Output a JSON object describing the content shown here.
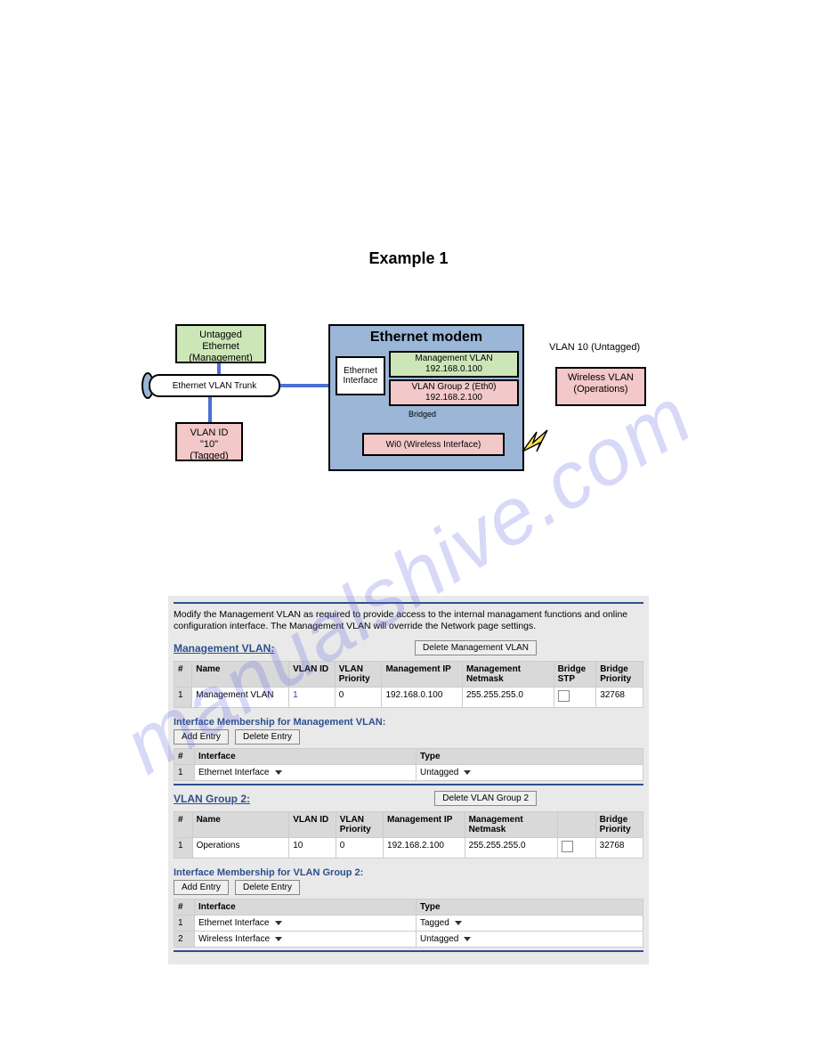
{
  "example_title": "Example 1",
  "diagram": {
    "untagged_eth": "Untagged\nEthernet\n(Management)",
    "trunk": "Ethernet VLAN Trunk",
    "vlanid10": "VLAN ID\n\"10\"\n(Tagged)",
    "modem_title": "Ethernet modem",
    "eth_if": "Ethernet\nInterface",
    "mgmt_vlan": "Management VLAN\n192.168.0.100",
    "vlan_group2": "VLAN Group 2 (Eth0)\n192.168.2.100",
    "bridged": "Bridged",
    "wi0": "Wi0 (Wireless Interface)",
    "vlan10_label": "VLAN 10 (Untagged)",
    "wireless_vlan": "Wireless VLAN\n(Operations)"
  },
  "form": {
    "description": "Modify the Management VLAN as required to provide access to the internal managament functions and online configuration interface. The Management VLAN will override the Network page settings.",
    "mgmt_vlan_link": "Management VLAN:",
    "delete_mgmt_btn": "Delete Management VLAN",
    "vlan_headers": {
      "num": "#",
      "name": "Name",
      "vlan_id": "VLAN ID",
      "vlan_priority": "VLAN\nPriority",
      "mgmt_ip": "Management IP",
      "mgmt_netmask": "Management\nNetmask",
      "bridge_stp": "Bridge\nSTP",
      "bridge_priority": "Bridge\nPriority"
    },
    "mgmt_row": {
      "num": "1",
      "name": "Management VLAN",
      "vlan_id": "1",
      "vlan_priority": "0",
      "mgmt_ip": "192.168.0.100",
      "mgmt_netmask": "255.255.255.0",
      "bridge_priority": "32768"
    },
    "if_membership_mgmt_title": "Interface Membership for Management VLAN:",
    "add_entry_btn": "Add Entry",
    "delete_entry_btn": "Delete Entry",
    "if_headers": {
      "num": "#",
      "interface": "Interface",
      "type": "Type"
    },
    "mgmt_if_row": {
      "num": "1",
      "interface": "Ethernet Interface",
      "type": "Untagged"
    },
    "vlan_group2_link": "VLAN Group 2:",
    "delete_vg2_btn": "Delete VLAN Group 2",
    "vg2_row": {
      "num": "1",
      "name": "Operations",
      "vlan_id": "10",
      "vlan_priority": "0",
      "mgmt_ip": "192.168.2.100",
      "mgmt_netmask": "255.255.255.0",
      "bridge_priority": "32768"
    },
    "if_membership_vg2_title": "Interface Membership for VLAN Group 2:",
    "vg2_if_row1": {
      "num": "1",
      "interface": "Ethernet Interface",
      "type": "Tagged"
    },
    "vg2_if_row2": {
      "num": "2",
      "interface": "Wireless Interface",
      "type": "Untagged"
    }
  },
  "watermark": "manualshive.com"
}
